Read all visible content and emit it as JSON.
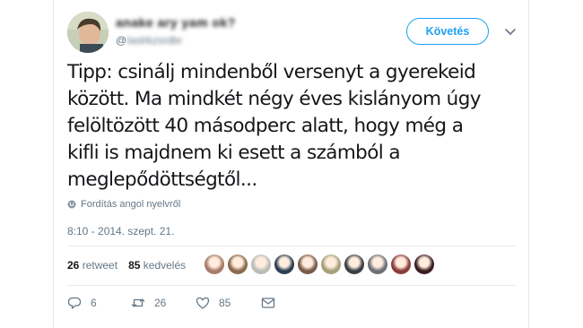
{
  "author": {
    "name": "anake ary yam ok?",
    "handle_prefix": "@",
    "handle_rest": "Iaslrkzsrdbr"
  },
  "follow_label": "Követés",
  "tweet_text": "Tipp: csinálj mindenből versenyt a gyerekeid\nközött. Ma mindkét négy éves kislányom úgy\nfelöltözött 40 másodperc alatt, hogy még a\nkifli is majdnem ki esett a számból a\nmeglepődöttségtől...",
  "translate_label": "Fordítás angol nyelvről",
  "timestamp": "8:10 - 2014. szept. 21.",
  "stats": {
    "retweets_count": "26",
    "retweets_label": "retweet",
    "likes_count": "85",
    "likes_label": "kedvelés"
  },
  "liker_colors": [
    "#a87b6a",
    "#8a6a4e",
    "#b9bdb7",
    "#2e3e52",
    "#7a5b4a",
    "#a5a07a",
    "#3a3f45",
    "#6e7075",
    "#8b3b3b",
    "#3a1e22"
  ],
  "actions": {
    "reply_count": "6",
    "retweet_count": "26",
    "like_count": "85"
  },
  "colors": {
    "accent": "#1da1f2",
    "text": "#14171a",
    "secondary": "#657786"
  }
}
